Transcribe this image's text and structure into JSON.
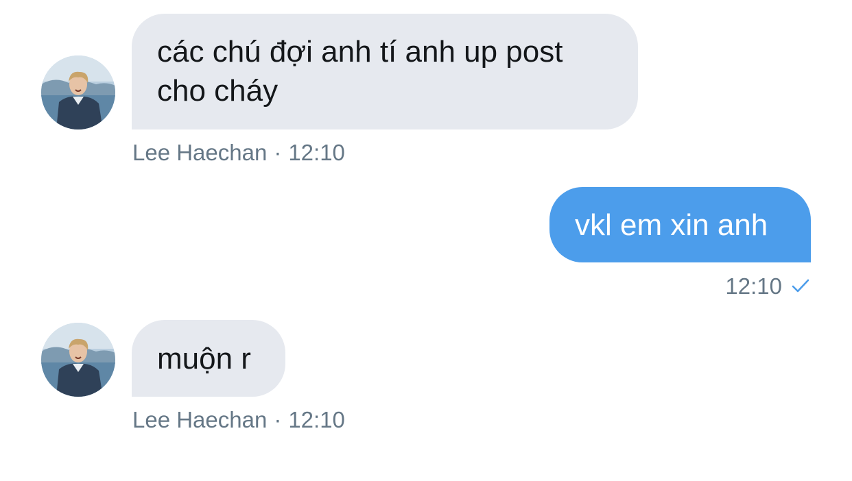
{
  "conversation": {
    "messages": [
      {
        "direction": "incoming",
        "text": "các chú đợi anh tí anh up post cho cháy",
        "sender": "Lee Haechan",
        "separator": "·",
        "time": "12:10"
      },
      {
        "direction": "outgoing",
        "text": "vkl em xin anh",
        "time": "12:10",
        "status_icon": "checkmark-icon"
      },
      {
        "direction": "incoming",
        "text": "muộn r",
        "sender": "Lee Haechan",
        "separator": "·",
        "time": "12:10"
      }
    ]
  },
  "colors": {
    "incoming_bubble": "#e6e9ef",
    "outgoing_bubble": "#4c9deb",
    "meta_text": "#657786",
    "read_check": "#4c9deb"
  }
}
